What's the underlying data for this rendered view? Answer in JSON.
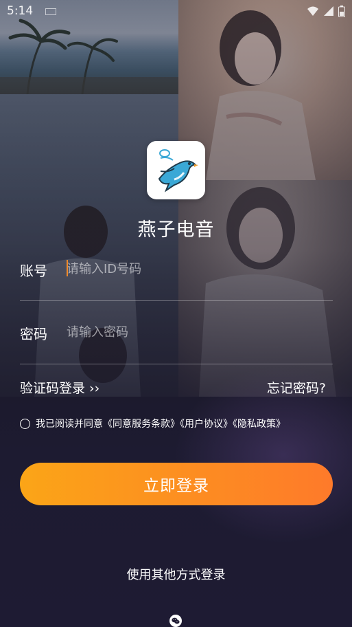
{
  "status_bar": {
    "time": "5:14"
  },
  "app": {
    "name": "燕子电音"
  },
  "form": {
    "account": {
      "label": "账号",
      "placeholder": "请输入ID号码",
      "value": ""
    },
    "password": {
      "label": "密码",
      "placeholder": "请输入密码",
      "value": ""
    }
  },
  "links": {
    "sms_login": "验证码登录 ››",
    "forgot_password": "忘记密码?"
  },
  "agreement": {
    "text": "我已阅读并同意《同意服务条款》《用户协议》《隐私政策》",
    "checked": false
  },
  "login_button": {
    "label": "立即登录"
  },
  "other_login": {
    "label": "使用其他方式登录"
  },
  "colors": {
    "accent_start": "#fba517",
    "accent_end": "#fe7a2a",
    "background": "#1e1b33",
    "logo_bird": "#3aa8d6"
  },
  "icons": [
    "wifi-icon",
    "signal-icon",
    "battery-icon",
    "swallow-logo-icon",
    "wechat-icon",
    "radio-icon"
  ]
}
